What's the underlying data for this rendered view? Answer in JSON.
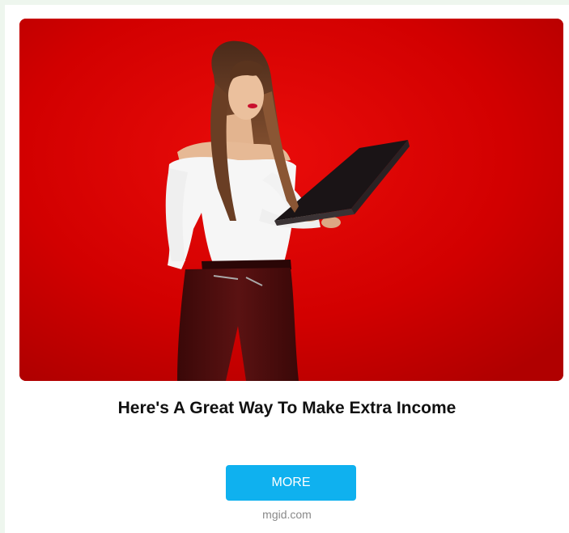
{
  "ad": {
    "image_alt": "Woman holding a laptop on a red background",
    "headline": "Here's A Great Way To Make Extra Income",
    "button_label": "MORE",
    "source": "mgid.com"
  },
  "colors": {
    "background": "#eef6ee",
    "card": "#ffffff",
    "image_background": "#d00000",
    "button": "#0fb1ef",
    "button_text": "#ffffff",
    "headline": "#111111",
    "source_text": "#8a8a8a"
  }
}
